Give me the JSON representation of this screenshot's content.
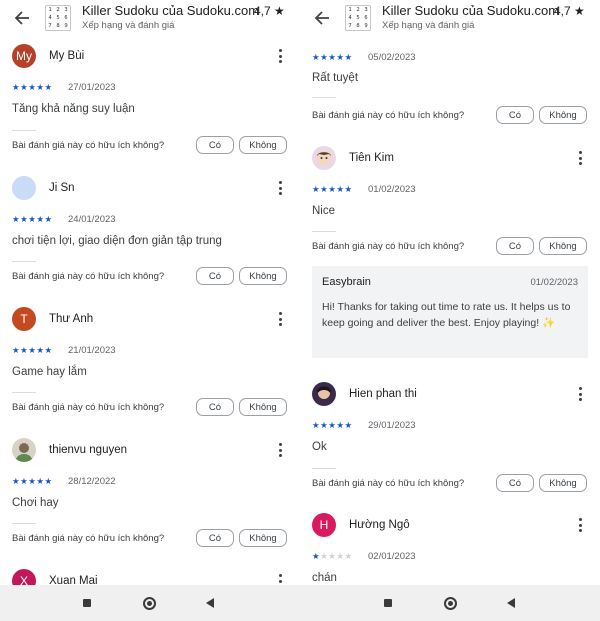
{
  "app": {
    "title": "Killer Sudoku của Sudoku.com",
    "subtitle": "Xếp hạng và đánh giá",
    "rating": "4,7 ★",
    "icon_digits": [
      "1",
      "2",
      "3",
      "4",
      "5",
      "6",
      "7",
      "8",
      "9"
    ]
  },
  "labels": {
    "helpful_question": "Bài đánh giá này có hữu ích không?",
    "yes": "Có",
    "no": "Không"
  },
  "left": {
    "reviews": [
      {
        "avatar_letter": "My",
        "avatar_color": "#b5412a",
        "name": "My Bùi",
        "stars": 5,
        "stars_text": "★★★★★",
        "date": "27/01/2023",
        "text": "Tăng khả năng suy luận"
      },
      {
        "avatar_letter": "",
        "avatar_color": "#c9dcf7",
        "name": "Ji Sn",
        "stars": 5,
        "stars_text": "★★★★★",
        "date": "24/01/2023",
        "text": "chơi tiện lợi, giao diện đơn giản tập trung"
      },
      {
        "avatar_letter": "T",
        "avatar_color": "#c34a20",
        "name": "Thư Anh",
        "stars": 5,
        "stars_text": "★★★★★",
        "date": "21/01/2023",
        "text": "Game hay lắm"
      },
      {
        "avatar_letter": "",
        "avatar_color": "#d8d2c4",
        "name": "thienvu nguyen",
        "stars": 5,
        "stars_text": "★★★★★",
        "date": "28/12/2022",
        "text": "Chơi hay"
      },
      {
        "avatar_letter": "X",
        "avatar_color": "#c2185b",
        "name": "Xuan Mai"
      }
    ]
  },
  "right": {
    "top_review": {
      "stars": 5,
      "stars_text": "★★★★★",
      "date": "05/02/2023",
      "text": "Rất tuyệt"
    },
    "reviews": [
      {
        "avatar_letter": "",
        "avatar_color": "#e9d9e6",
        "name": "Tiên Kim",
        "stars": 5,
        "stars_text": "★★★★★",
        "date": "01/02/2023",
        "text": "Nice"
      },
      {
        "avatar_letter": "",
        "avatar_color": "#3b2b4a",
        "name": "Hien phan thi",
        "stars": 5,
        "stars_text": "★★★★★",
        "date": "29/01/2023",
        "text": "Ok"
      },
      {
        "avatar_letter": "H",
        "avatar_color": "#d81b60",
        "name": "Hường Ngô",
        "stars": 1,
        "stars_on": "★",
        "stars_off": "★★★★",
        "date": "02/01/2023",
        "text": "chán"
      }
    ],
    "developer_reply": {
      "name": "Easybrain",
      "date": "01/02/2023",
      "text": "Hi! Thanks for taking out time to rate us. It helps us to keep going and deliver the best. Enjoy playing! ✨"
    }
  },
  "colors": {
    "star_active": "#1a56c4",
    "star_inactive": "#d0d0d0"
  },
  "icons": {
    "back": "arrow-left-icon",
    "more": "more-vert-icon",
    "nav_recents": "square-icon",
    "nav_home": "circle-icon",
    "nav_back": "triangle-icon"
  }
}
